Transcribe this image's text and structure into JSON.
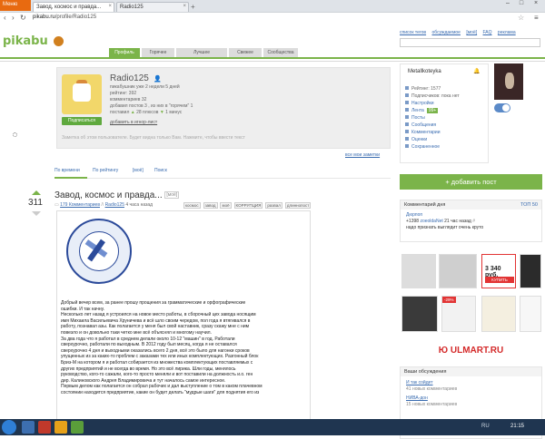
{
  "browser": {
    "menu_label": "Меню",
    "tabs": [
      {
        "title": "Завод, космос и правда..."
      },
      {
        "title": "Radio125"
      }
    ],
    "url_domain": "pikabu.ru",
    "url_path": "/profile/Radio125"
  },
  "header": {
    "logo": "pikabu",
    "top_links": [
      "список тегов",
      "обсуждаемое",
      "[моё]",
      "FAQ",
      "реклама"
    ],
    "nav_tabs": [
      "Профиль",
      "Горячее",
      "Лучшее",
      "Свежее",
      "Сообщества"
    ],
    "active_tab": "Профиль"
  },
  "profile": {
    "name": "Radio125",
    "stats": {
      "pikabushnik": "пикабушник уже 2 недели 5 дней",
      "rating": "рейтинг: 392",
      "comments": "комментариев 32",
      "posts": "добавил постов 3 , из них в \"горячем\" 1",
      "likes": "поставил",
      "plus": "28 плюсов",
      "minus": "1 минус"
    },
    "subscribe_label": "Подписаться",
    "ignore_label": "добавить в игнор-лист",
    "note": "Заметка об этом пользователе. Будет видна только Вам. Нажмите, чтобы ввести текст",
    "all_notes": "все мои заметки"
  },
  "sort_tabs": [
    "По времени",
    "По рейтингу",
    "[моё]",
    "Поиск"
  ],
  "post": {
    "votes": "311",
    "title": "Завод, космос и правда...",
    "title_tag": "[моё]",
    "comments_link": "179 Комментариев",
    "author": "Radio125",
    "time": "4 часа назад",
    "tags": [
      "космос",
      "завод",
      "моё",
      "КОРРУПЦИЯ",
      "развал",
      "длиннопост"
    ],
    "text": [
      "Добрый вечер всем, за ранее прошу прощения за грамматические и орфографические",
      "ошибки. И так начну.",
      "Несколько лет назад я устроился на новое место работы, в сборочный цех завода носящим",
      "имя Михаила Васильевича Хруничева и всё шло своим чередом, пол года я втягивался в",
      "работу, познавал азы. Как полагается у меня был свой наставник, сразу скажу мне с ним",
      "повезло и он довольно таки четко мне всё объяснял и многому научил.",
      "За два года что я работал в среднем делали около 10-12 \"машин\" в год.  Работали",
      "сверхурочно, работали по выходным. В 2012 году был месяц, когда я не оставался",
      "сверхурочно 4 дня и выходными оказались всего 2 дня, всё это было для нагонки сроков",
      "упущенных из за каких-то проблем с заказами тех или иных комплектующих. Разгонный блок",
      "Бриз-М на котором я и работал собирается из множества комплектующих поставляемых с",
      "других предприятий и не всегда во время. Но это всё лирика. Шли годы, менялось",
      "руководство, кого-то сажали, кого-то просто меняли и вот поставили на должность и.о. ген",
      "дир. Калиновского Андрея Владимировича и тут началось самое интересное.",
      "Первым делом как полагается он собрал рабочих и дал выступление о том в каком плачевном",
      "состоянии находится предприятие, какие он будет делать \"мудрые шаги\" для поднятия его из"
    ]
  },
  "sidebar": {
    "user": "Metallkoteyka",
    "items": [
      {
        "label": "Рейтинг: 1577",
        "plain": true
      },
      {
        "label": "Подписчиков: пока нет",
        "plain": true
      },
      {
        "label": "Настройки"
      },
      {
        "label": "Лента",
        "badge": "99+"
      },
      {
        "label": "Посты"
      },
      {
        "label": "Сообщения"
      },
      {
        "label": "Комментарии"
      },
      {
        "label": "Оценки"
      },
      {
        "label": "Сохраненное"
      }
    ],
    "add_post": "+ добавить пост",
    "comment_of_day": {
      "header": "Комментарий дня",
      "top": "ТОП 50",
      "user": "Дюрпоп",
      "score": "+1398",
      "meta_user": "zoeoldaNet",
      "meta_time": "21 час назад",
      "text": "надо признать выглядит очень круто"
    },
    "ad": {
      "price": "3 340 руб.",
      "buy": "КУПИТЬ",
      "discount": "-29%",
      "brand": "Ю ULMART.RU"
    },
    "discussions": {
      "header": "Ваши обсуждения",
      "items": [
        {
          "title": "И так сойдет",
          "count": "41 новых комментариев"
        },
        {
          "title": "НИВА-дон",
          "count": "15 новых комментариев"
        }
      ]
    }
  },
  "taskbar": {
    "lang": "RU",
    "clock": "21:15"
  },
  "colors": {
    "brand_green": "#7bb44a",
    "link_blue": "#3a6cb0",
    "ad_red": "#e23434"
  }
}
